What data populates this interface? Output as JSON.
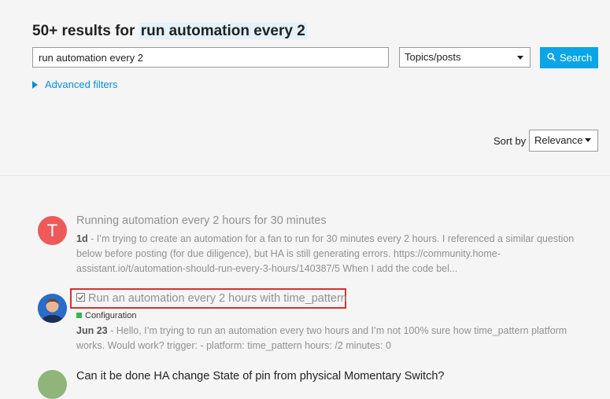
{
  "header": {
    "title_prefix": "50+ results for",
    "query_highlight": "run automation every 2",
    "search_value": "run automation every 2",
    "type_select": "Topics/posts",
    "search_button": "Search",
    "advanced_filters": "Advanced filters",
    "sort_label": "Sort by",
    "sort_value": "Relevance"
  },
  "results": [
    {
      "avatar_letter": "T",
      "title": "Running automation every 2 hours for 30 minutes",
      "date": "1d",
      "blurb": " - I’m trying to create an automation for a fan to run for 30 minutes every 2 hours. I referenced a similar question below before posting (for due diligence), but HA is still generating errors. https://community.home-assistant.io/t/automation-should-run-every-3-hours/140387/5 When I add the code bel..."
    },
    {
      "title": "Run an automation every 2 hours with time_pattern",
      "category": "Configuration",
      "date": "Jun 23",
      "blurb": " - Hello, I’m trying to run an automation every two hours and I’m not 100% sure how time_pattern platform works. Would work? trigger: - platform: time_pattern hours: /2 minutes: 0"
    },
    {
      "title": "Can it be done HA change State of pin from physical Momentary Switch?"
    }
  ],
  "colors": {
    "accent": "#08a5e8",
    "link": "#0a8ed9",
    "highlight_border": "#d93030",
    "category": "#3ab54a"
  }
}
